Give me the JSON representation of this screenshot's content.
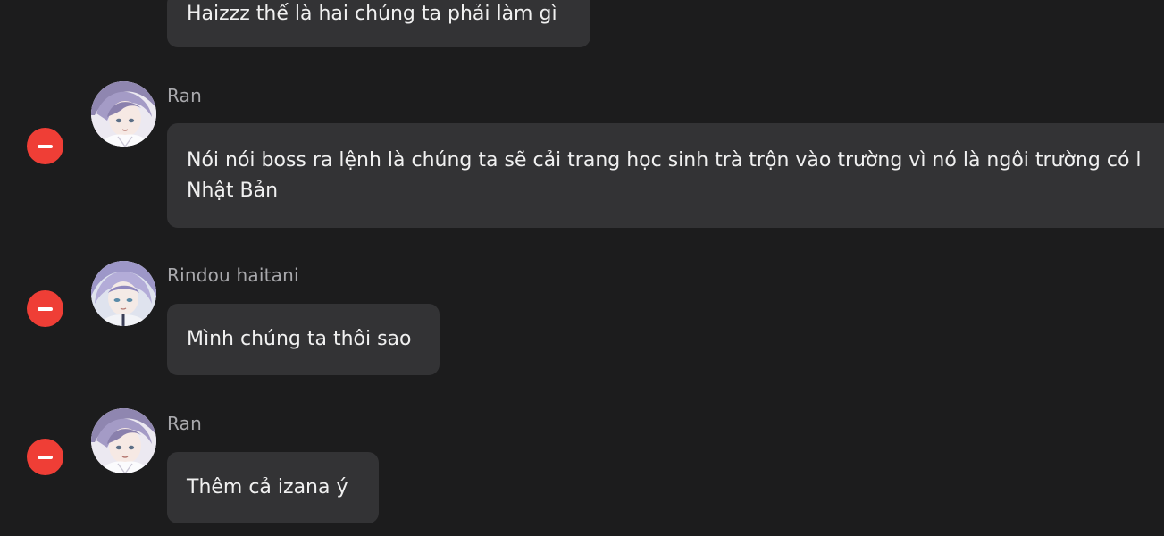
{
  "messages": [
    {
      "sender": "",
      "text": "Haizzz thế là hai chúng ta phải làm gì"
    },
    {
      "sender": "Ran",
      "text": "Nói nói boss ra lệnh là chúng ta sẽ cải trang học sinh trà trộn vào trường vì nó là ngôi trường có l\nNhật Bản",
      "avatar": "ran-avatar"
    },
    {
      "sender": "Rindou haitani",
      "text": "Mình chúng ta thôi sao",
      "avatar": "rindou-avatar"
    },
    {
      "sender": "Ran",
      "text": "Thêm cả izana ý",
      "avatar": "ran-avatar"
    }
  ],
  "colors": {
    "background": "#1c1c1d",
    "bubble": "#333335",
    "remove_button": "#ef3e36",
    "sender_name": "#a9a9ad"
  },
  "icons": {
    "remove": "minus-circle-icon"
  }
}
